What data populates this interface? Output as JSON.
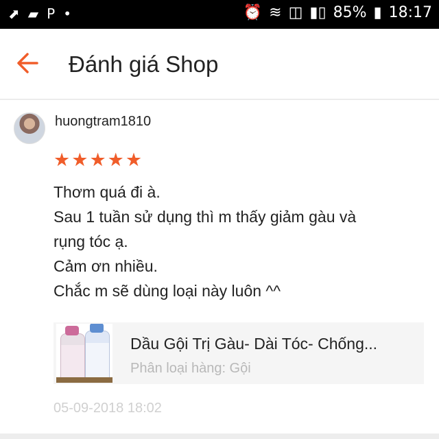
{
  "status_bar": {
    "battery": "85%",
    "time": "18:17",
    "icons_left": [
      "nav-arrow-icon",
      "chat-icon",
      "p-icon",
      "dot-icon"
    ],
    "icons_right": [
      "alarm-icon",
      "wifi-icon",
      "call-icon",
      "signal-icon",
      "battery-icon"
    ]
  },
  "header": {
    "title": "Đánh giá Shop",
    "back_icon": "back-arrow-icon",
    "accent": "#f05d2a"
  },
  "review": {
    "username": "huongtram1810",
    "rating": 5,
    "rating_max": 5,
    "stars_text": "★★★★★",
    "comment_lines": [
      "Thơm quá đi à.",
      "Sau 1 tuần sử dụng thì m thấy giảm gàu và",
      "rụng tóc ạ.",
      "Cảm ơn nhiều.",
      "Chắc m sẽ dùng loại này luôn ^^"
    ],
    "product": {
      "name": "Dầu Gội Trị Gàu- Dài Tóc- Chống...",
      "variant": "Phân loại hàng: Gội"
    },
    "date": "05-09-2018 18:02"
  }
}
